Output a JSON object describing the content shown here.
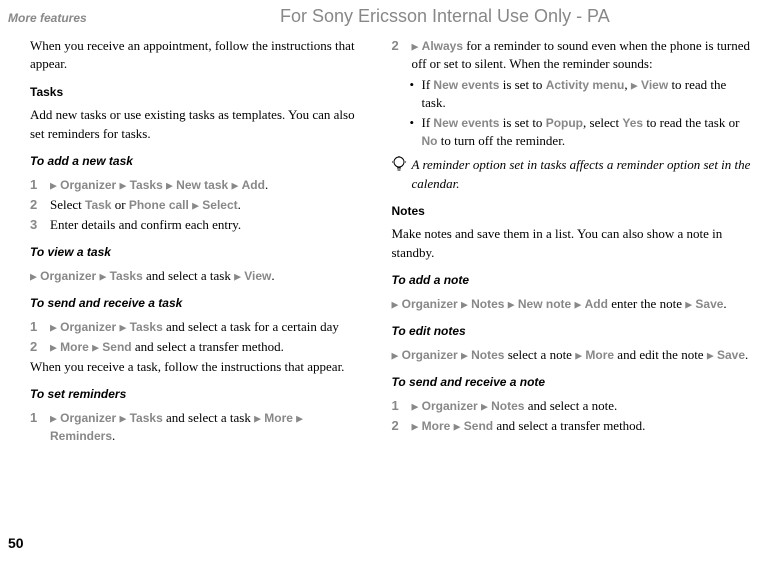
{
  "header": {
    "section": "More features",
    "watermark": "For Sony Ericsson Internal Use Only - PA"
  },
  "col1": {
    "intro": "When you receive an appointment, follow the instructions that appear.",
    "tasks_heading": "Tasks",
    "tasks_desc": "Add new tasks or use existing tasks as templates. You can also set reminders for tasks.",
    "add_task_heading": "To add a new task",
    "add_task_1_pre": "",
    "add_task_1_m1": "Organizer",
    "add_task_1_m2": "Tasks",
    "add_task_1_m3": "New task",
    "add_task_1_m4": "Add",
    "add_task_2_pre": "Select ",
    "add_task_2_m1": "Task",
    "add_task_2_mid": " or ",
    "add_task_2_m2": "Phone call",
    "add_task_2_m3": "Select",
    "add_task_3": "Enter details and confirm each entry.",
    "view_task_heading": "To view a task",
    "view_task_m1": "Organizer",
    "view_task_m2": "Tasks",
    "view_task_mid": " and select a task ",
    "view_task_m3": "View",
    "send_task_heading": "To send and receive a task",
    "send_task_1_m1": "Organizer",
    "send_task_1_m2": "Tasks",
    "send_task_1_post": " and select a task for a certain day",
    "send_task_2_m1": "More",
    "send_task_2_m2": "Send",
    "send_task_2_post": " and select a transfer method.",
    "send_task_follow": "When you receive a task, follow the instructions that appear.",
    "set_rem_heading": "To set reminders",
    "set_rem_1_m1": "Organizer",
    "set_rem_1_m2": "Tasks",
    "set_rem_1_mid": " and select a task ",
    "set_rem_1_m3": "More",
    "set_rem_1_m4": "Reminders"
  },
  "col2": {
    "step2_m1": "Always",
    "step2_post": " for a reminder to sound even when the phone is turned off or set to silent. When the reminder sounds:",
    "bullet1_pre": "If ",
    "bullet1_m1": "New events",
    "bullet1_mid": " is set to ",
    "bullet1_m2": "Activity menu",
    "bullet1_m3": "View",
    "bullet1_post": " to read the task.",
    "bullet2_pre": "If ",
    "bullet2_m1": "New events",
    "bullet2_mid1": " is set to ",
    "bullet2_m2": "Popup",
    "bullet2_mid2": ", select ",
    "bullet2_m3": "Yes",
    "bullet2_mid3": " to read the task or ",
    "bullet2_m4": "No",
    "bullet2_post": " to turn off the reminder.",
    "tip": "A reminder option set in tasks affects a reminder option set in the calendar.",
    "notes_heading": "Notes",
    "notes_desc": "Make notes and save them in a list. You can also show a note in standby.",
    "add_note_heading": "To add a note",
    "add_note_m1": "Organizer",
    "add_note_m2": "Notes",
    "add_note_m3": "New note",
    "add_note_m4": "Add",
    "add_note_mid": " enter the note ",
    "add_note_m5": "Save",
    "edit_notes_heading": "To edit notes",
    "edit_notes_m1": "Organizer",
    "edit_notes_m2": "Notes",
    "edit_notes_mid1": " select a note ",
    "edit_notes_m3": "More",
    "edit_notes_mid2": " and edit the note ",
    "edit_notes_m4": "Save",
    "send_note_heading": "To send and receive a note",
    "send_note_1_m1": "Organizer",
    "send_note_1_m2": "Notes",
    "send_note_1_post": " and select a note.",
    "send_note_2_m1": "More",
    "send_note_2_m2": "Send",
    "send_note_2_post": " and select a transfer method."
  },
  "page_number": "50",
  "glyphs": {
    "tri": "▶",
    "bullet": "•",
    "period": "."
  }
}
